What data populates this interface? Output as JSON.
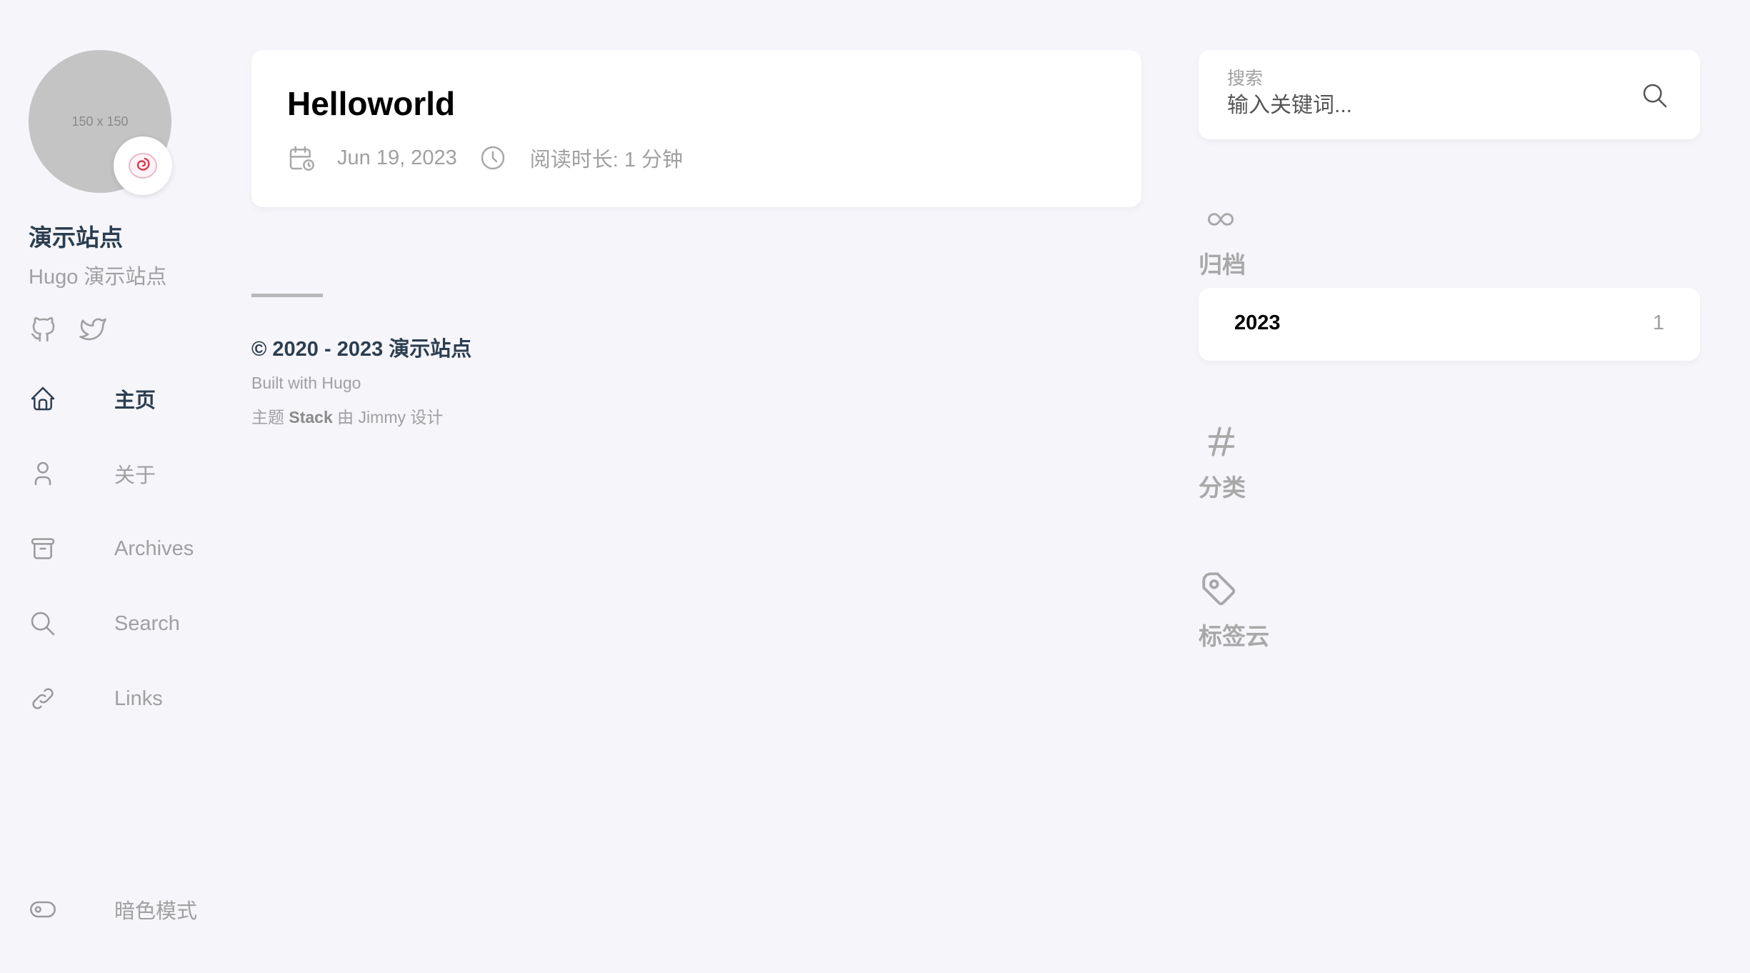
{
  "profile": {
    "avatar_text": "150 x 150",
    "emoji": "🍥",
    "site_name": "演示站点",
    "site_description": "Hugo 演示站点"
  },
  "social": [
    "github-icon",
    "twitter-icon"
  ],
  "nav": {
    "items": [
      {
        "label": "主页",
        "icon": "home-icon",
        "active": true
      },
      {
        "label": "关于",
        "icon": "user-icon",
        "active": false
      },
      {
        "label": "Archives",
        "icon": "archive-icon",
        "active": false
      },
      {
        "label": "Search",
        "icon": "search-icon",
        "active": false
      },
      {
        "label": "Links",
        "icon": "link-icon",
        "active": false
      }
    ],
    "dark_mode_label": "暗色模式"
  },
  "article": {
    "title": "Helloworld",
    "date": "Jun 19, 2023",
    "reading_time": "阅读时长: 1 分钟"
  },
  "footer": {
    "copyright": "© 2020 - 2023 演示站点",
    "built_with": "Built with Hugo",
    "theme_prefix": "主题",
    "theme_name": "Stack",
    "theme_suffix": "由 Jimmy 设计"
  },
  "search": {
    "label": "搜索",
    "placeholder": "输入关键词..."
  },
  "widgets": {
    "archives": {
      "title": "归档",
      "year": "2023",
      "count": "1"
    },
    "categories": {
      "title": "分类"
    },
    "tags": {
      "title": "标签云"
    }
  },
  "colors": {
    "background": "#f5f5fa",
    "card": "#ffffff",
    "accent_text": "#2c3e50",
    "muted_text": "#a0a0a0"
  }
}
